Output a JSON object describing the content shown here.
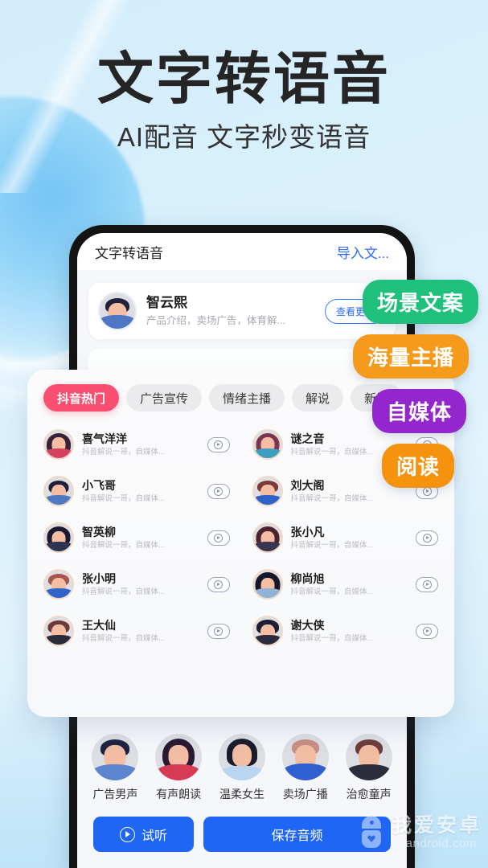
{
  "hero": {
    "title": "文字转语音",
    "subtitle": "AI配音 文字秒变语音"
  },
  "colors": {
    "page_bg": "#d6eefb",
    "accent_blue": "#1f66f5",
    "tab_active": "#fa4f70",
    "badge_green": "#1fc07c",
    "badge_orange": "#f59a1a",
    "badge_purple": "#9326cc",
    "badge_orange2": "#f5930f"
  },
  "app": {
    "header": {
      "title": "文字转语音",
      "import_link": "导入文..."
    },
    "speaker_card": {
      "name": "智云熙",
      "desc": "产品介绍，卖场广告，体育解...",
      "more_button": "查看更多",
      "avatar_icon": "avatar-male-curly"
    },
    "bottom_avatars": [
      {
        "label": "广告男声",
        "icon": "avatar-male-blue"
      },
      {
        "label": "有声朗读",
        "icon": "avatar-female-red"
      },
      {
        "label": "温柔女生",
        "icon": "avatar-female-bob"
      },
      {
        "label": "卖场广播",
        "icon": "avatar-male-blond"
      },
      {
        "label": "治愈童声",
        "icon": "avatar-male-dark"
      }
    ],
    "actions": {
      "preview_label": "试听",
      "preview_icon": "play-circle-icon",
      "save_label": "保存音频"
    }
  },
  "panel": {
    "tabs": [
      {
        "label": "抖音热门",
        "active": true
      },
      {
        "label": "广告宣传",
        "active": false
      },
      {
        "label": "情绪主播",
        "active": false
      },
      {
        "label": "解说",
        "active": false
      },
      {
        "label": "新闻",
        "active": false
      }
    ],
    "voice_desc": "抖音解说一哥，自媒体...",
    "play_icon": "play-button-icon",
    "voices": [
      {
        "name": "喜气洋洋",
        "desc": "抖音解说一哥，自媒体..."
      },
      {
        "name": "谜之音",
        "desc": "抖音解说一哥，自媒体..."
      },
      {
        "name": "小飞哥",
        "desc": "抖音解说一哥，自媒体..."
      },
      {
        "name": "刘大阁",
        "desc": "抖音解说一哥，自媒体..."
      },
      {
        "name": "智英柳",
        "desc": "抖音解说一哥，自媒体..."
      },
      {
        "name": "张小凡",
        "desc": "抖音解说一哥，自媒体..."
      },
      {
        "name": "张小明",
        "desc": "抖音解说一哥，自媒体..."
      },
      {
        "name": "柳尚旭",
        "desc": "抖音解说一哥，自媒体..."
      },
      {
        "name": "王大仙",
        "desc": "抖音解说一哥，自媒体..."
      },
      {
        "name": "谢大侠",
        "desc": "抖音解说一哥，自媒体..."
      }
    ]
  },
  "badges": [
    {
      "label": "场景文案",
      "color": "#1fc07c"
    },
    {
      "label": "海量主播",
      "color": "#f59a1a"
    },
    {
      "label": "自媒体",
      "color": "#9326cc"
    },
    {
      "label": "阅读",
      "color": "#f5930f"
    }
  ],
  "watermark": {
    "cn": "我爱安卓",
    "en": "52android.com",
    "icon": "android-robot-icon"
  }
}
